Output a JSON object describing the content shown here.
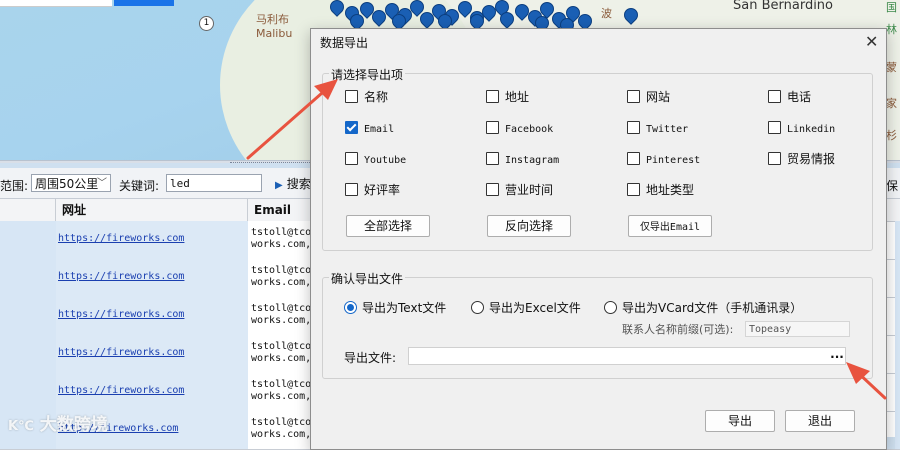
{
  "map": {
    "labels": {
      "malibu_cn": "马利布",
      "malibu": "Malibu",
      "san_bernardino": "San Bernardino",
      "bo": "波",
      "right_cn_1": "国",
      "right_cn_2": "林",
      "right_cn_3": "蒙",
      "right_cn_4": "家",
      "right_cn_5": "杉"
    },
    "route_badge": "1",
    "colors": {
      "pin": "#1a5fb4",
      "sea": "#a9d4ec"
    }
  },
  "toolbar": {
    "range_label": "范围:",
    "range_value": "周围50公里",
    "keyword_label": "关键词:",
    "keyword_value": "led",
    "search_label": "搜索",
    "right_label": "保"
  },
  "grid": {
    "headers": [
      "网址",
      "Email"
    ],
    "rows": [
      {
        "url": "https://fireworks.com",
        "email_line1": "tstoll@tcor",
        "email_line2": "works.com,s"
      },
      {
        "url": "https://fireworks.com",
        "email_line1": "tstoll@tcor",
        "email_line2": "works.com,s"
      },
      {
        "url": "https://fireworks.com",
        "email_line1": "tstoll@tcor",
        "email_line2": "works.com,s"
      },
      {
        "url": "https://fireworks.com",
        "email_line1": "tstoll@tcor",
        "email_line2": "works.com,s"
      },
      {
        "url": "https://fireworks.com",
        "email_line1": "tstoll@tcor",
        "email_line2": "works.com,s"
      },
      {
        "url": "http://fireworks.com",
        "email_line1": "tstoll@tcor",
        "email_line2": "works.com,s"
      }
    ]
  },
  "watermark": "大数跨境",
  "dialog": {
    "title": "数据导出",
    "close_glyph": "✕",
    "fields_group": {
      "legend": "请选择导出项",
      "checkboxes": [
        {
          "label": "名称",
          "checked": false
        },
        {
          "label": "地址",
          "checked": false
        },
        {
          "label": "网站",
          "checked": false
        },
        {
          "label": "电话",
          "checked": false
        },
        {
          "label": "Email",
          "checked": true
        },
        {
          "label": "Facebook",
          "checked": false
        },
        {
          "label": "Twitter",
          "checked": false
        },
        {
          "label": "Linkedin",
          "checked": false
        },
        {
          "label": "Youtube",
          "checked": false
        },
        {
          "label": "Instagram",
          "checked": false
        },
        {
          "label": "Pinterest",
          "checked": false
        },
        {
          "label": "贸易情报",
          "checked": false
        },
        {
          "label": "好评率",
          "checked": false
        },
        {
          "label": "营业时间",
          "checked": false
        },
        {
          "label": "地址类型",
          "checked": false
        }
      ],
      "select_all": "全部选择",
      "invert_select": "反向选择",
      "email_only": "仅导出Email"
    },
    "file_group": {
      "legend": "确认导出文件",
      "options": [
        {
          "label": "导出为Text文件",
          "selected": true
        },
        {
          "label": "导出为Excel文件",
          "selected": false
        },
        {
          "label": "导出为VCard文件（手机通讯录）",
          "selected": false
        }
      ],
      "prefix_label": "联系人名称前缀(可选):",
      "prefix_value": "Topeasy",
      "file_label": "导出文件:",
      "file_value": "",
      "browse": "..."
    },
    "export_button": "导出",
    "exit_button": "退出"
  }
}
